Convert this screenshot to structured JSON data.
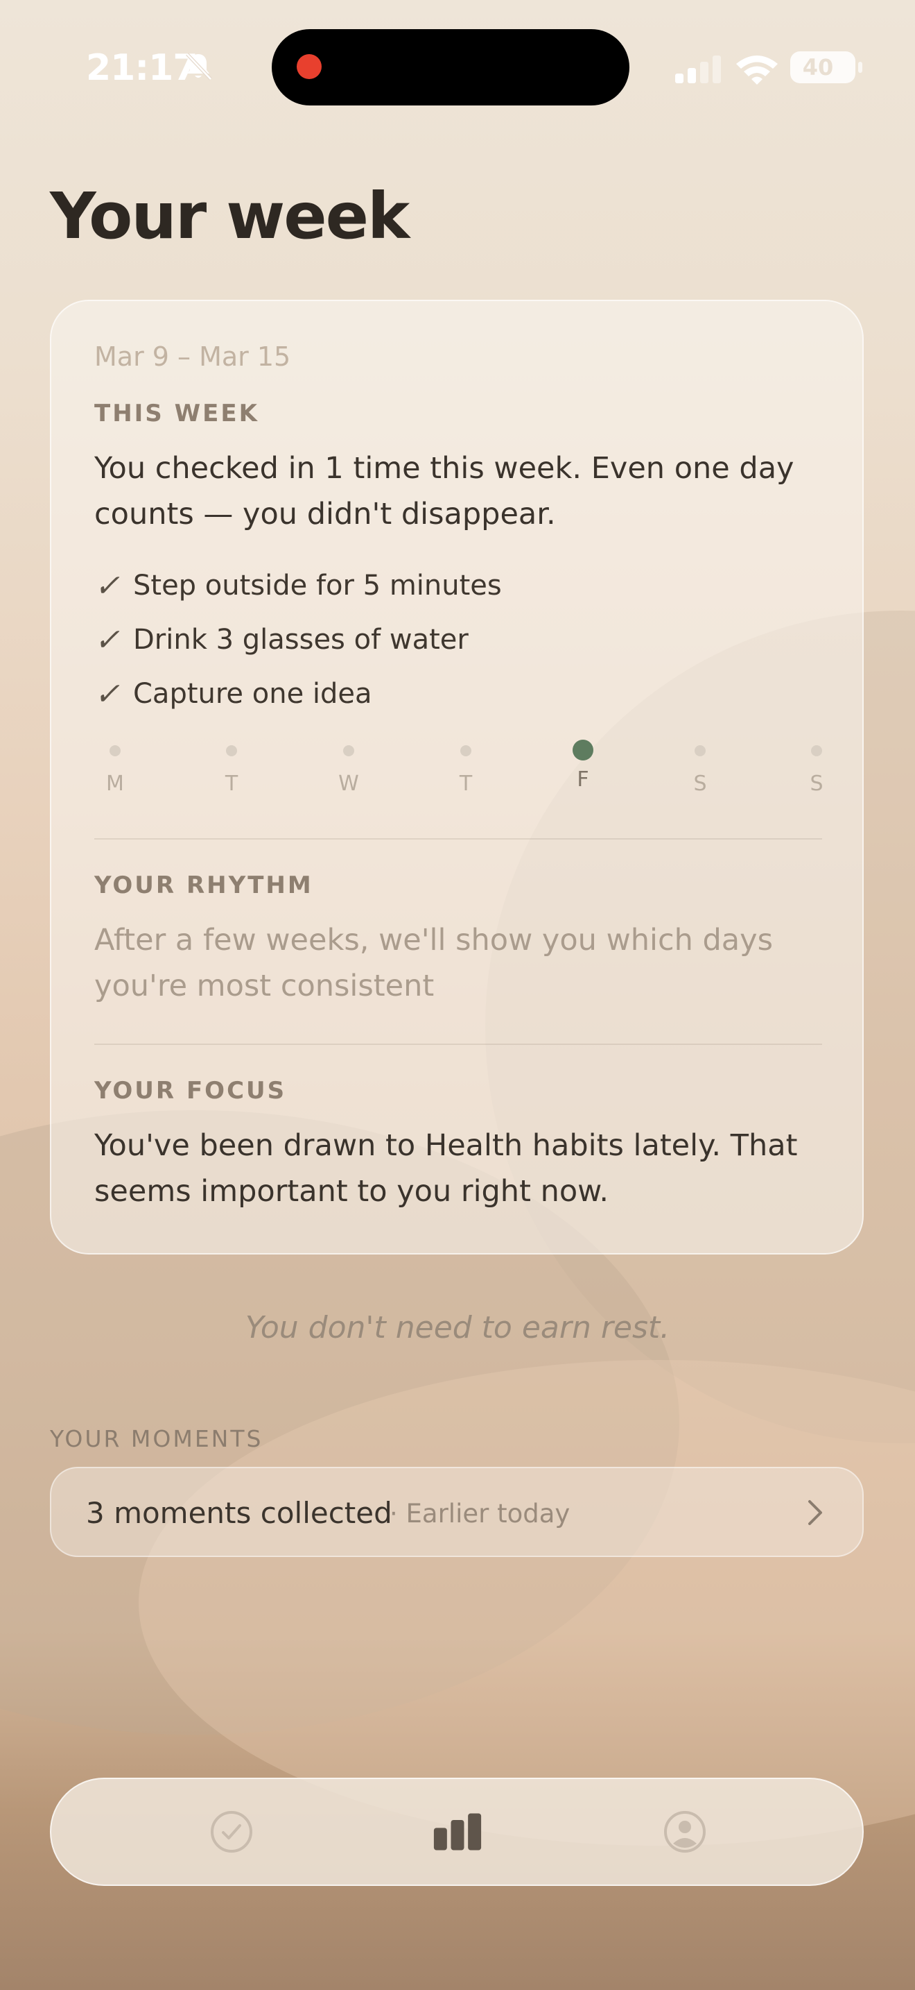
{
  "status_bar": {
    "time": "21:17",
    "battery": "40",
    "icons": [
      "bell-slash-icon",
      "cellular-signal-icon",
      "wifi-icon",
      "battery-icon"
    ],
    "recording_color": "#e8402e"
  },
  "header": {
    "title": "Your week"
  },
  "week_card": {
    "date_range": "Mar 9 – Mar 15",
    "this_week": {
      "label": "THIS WEEK",
      "summary": "You checked in 1 time this week. Even one day counts — you didn't disappear.",
      "habits": [
        {
          "check": "✓",
          "label": "Step outside for 5 minutes"
        },
        {
          "check": "✓",
          "label": "Drink 3 glasses of water"
        },
        {
          "check": "✓",
          "label": "Capture one idea"
        }
      ]
    },
    "days": [
      {
        "label": "M",
        "active": false
      },
      {
        "label": "T",
        "active": false
      },
      {
        "label": "W",
        "active": false
      },
      {
        "label": "T",
        "active": false
      },
      {
        "label": "F",
        "active": true
      },
      {
        "label": "S",
        "active": false
      },
      {
        "label": "S",
        "active": false
      }
    ],
    "rhythm": {
      "label": "YOUR RHYTHM",
      "text": "After a few weeks, we'll show you which days you're most consistent"
    },
    "focus": {
      "label": "YOUR FOCUS",
      "text": "You've been drawn to Health habits lately. That seems important to you right now."
    },
    "active_day_color": "#5e7c5f"
  },
  "quote": "You don't need to earn rest.",
  "moments": {
    "label": "YOUR MOMENTS",
    "count_text": "3 moments collected",
    "when_text": "· Earlier today",
    "icon": "chevron-right-icon"
  },
  "tab_bar": {
    "tabs": [
      {
        "icon": "check-circle-icon",
        "active": false
      },
      {
        "icon": "bar-chart-icon",
        "active": true
      },
      {
        "icon": "profile-icon",
        "active": false
      }
    ]
  }
}
